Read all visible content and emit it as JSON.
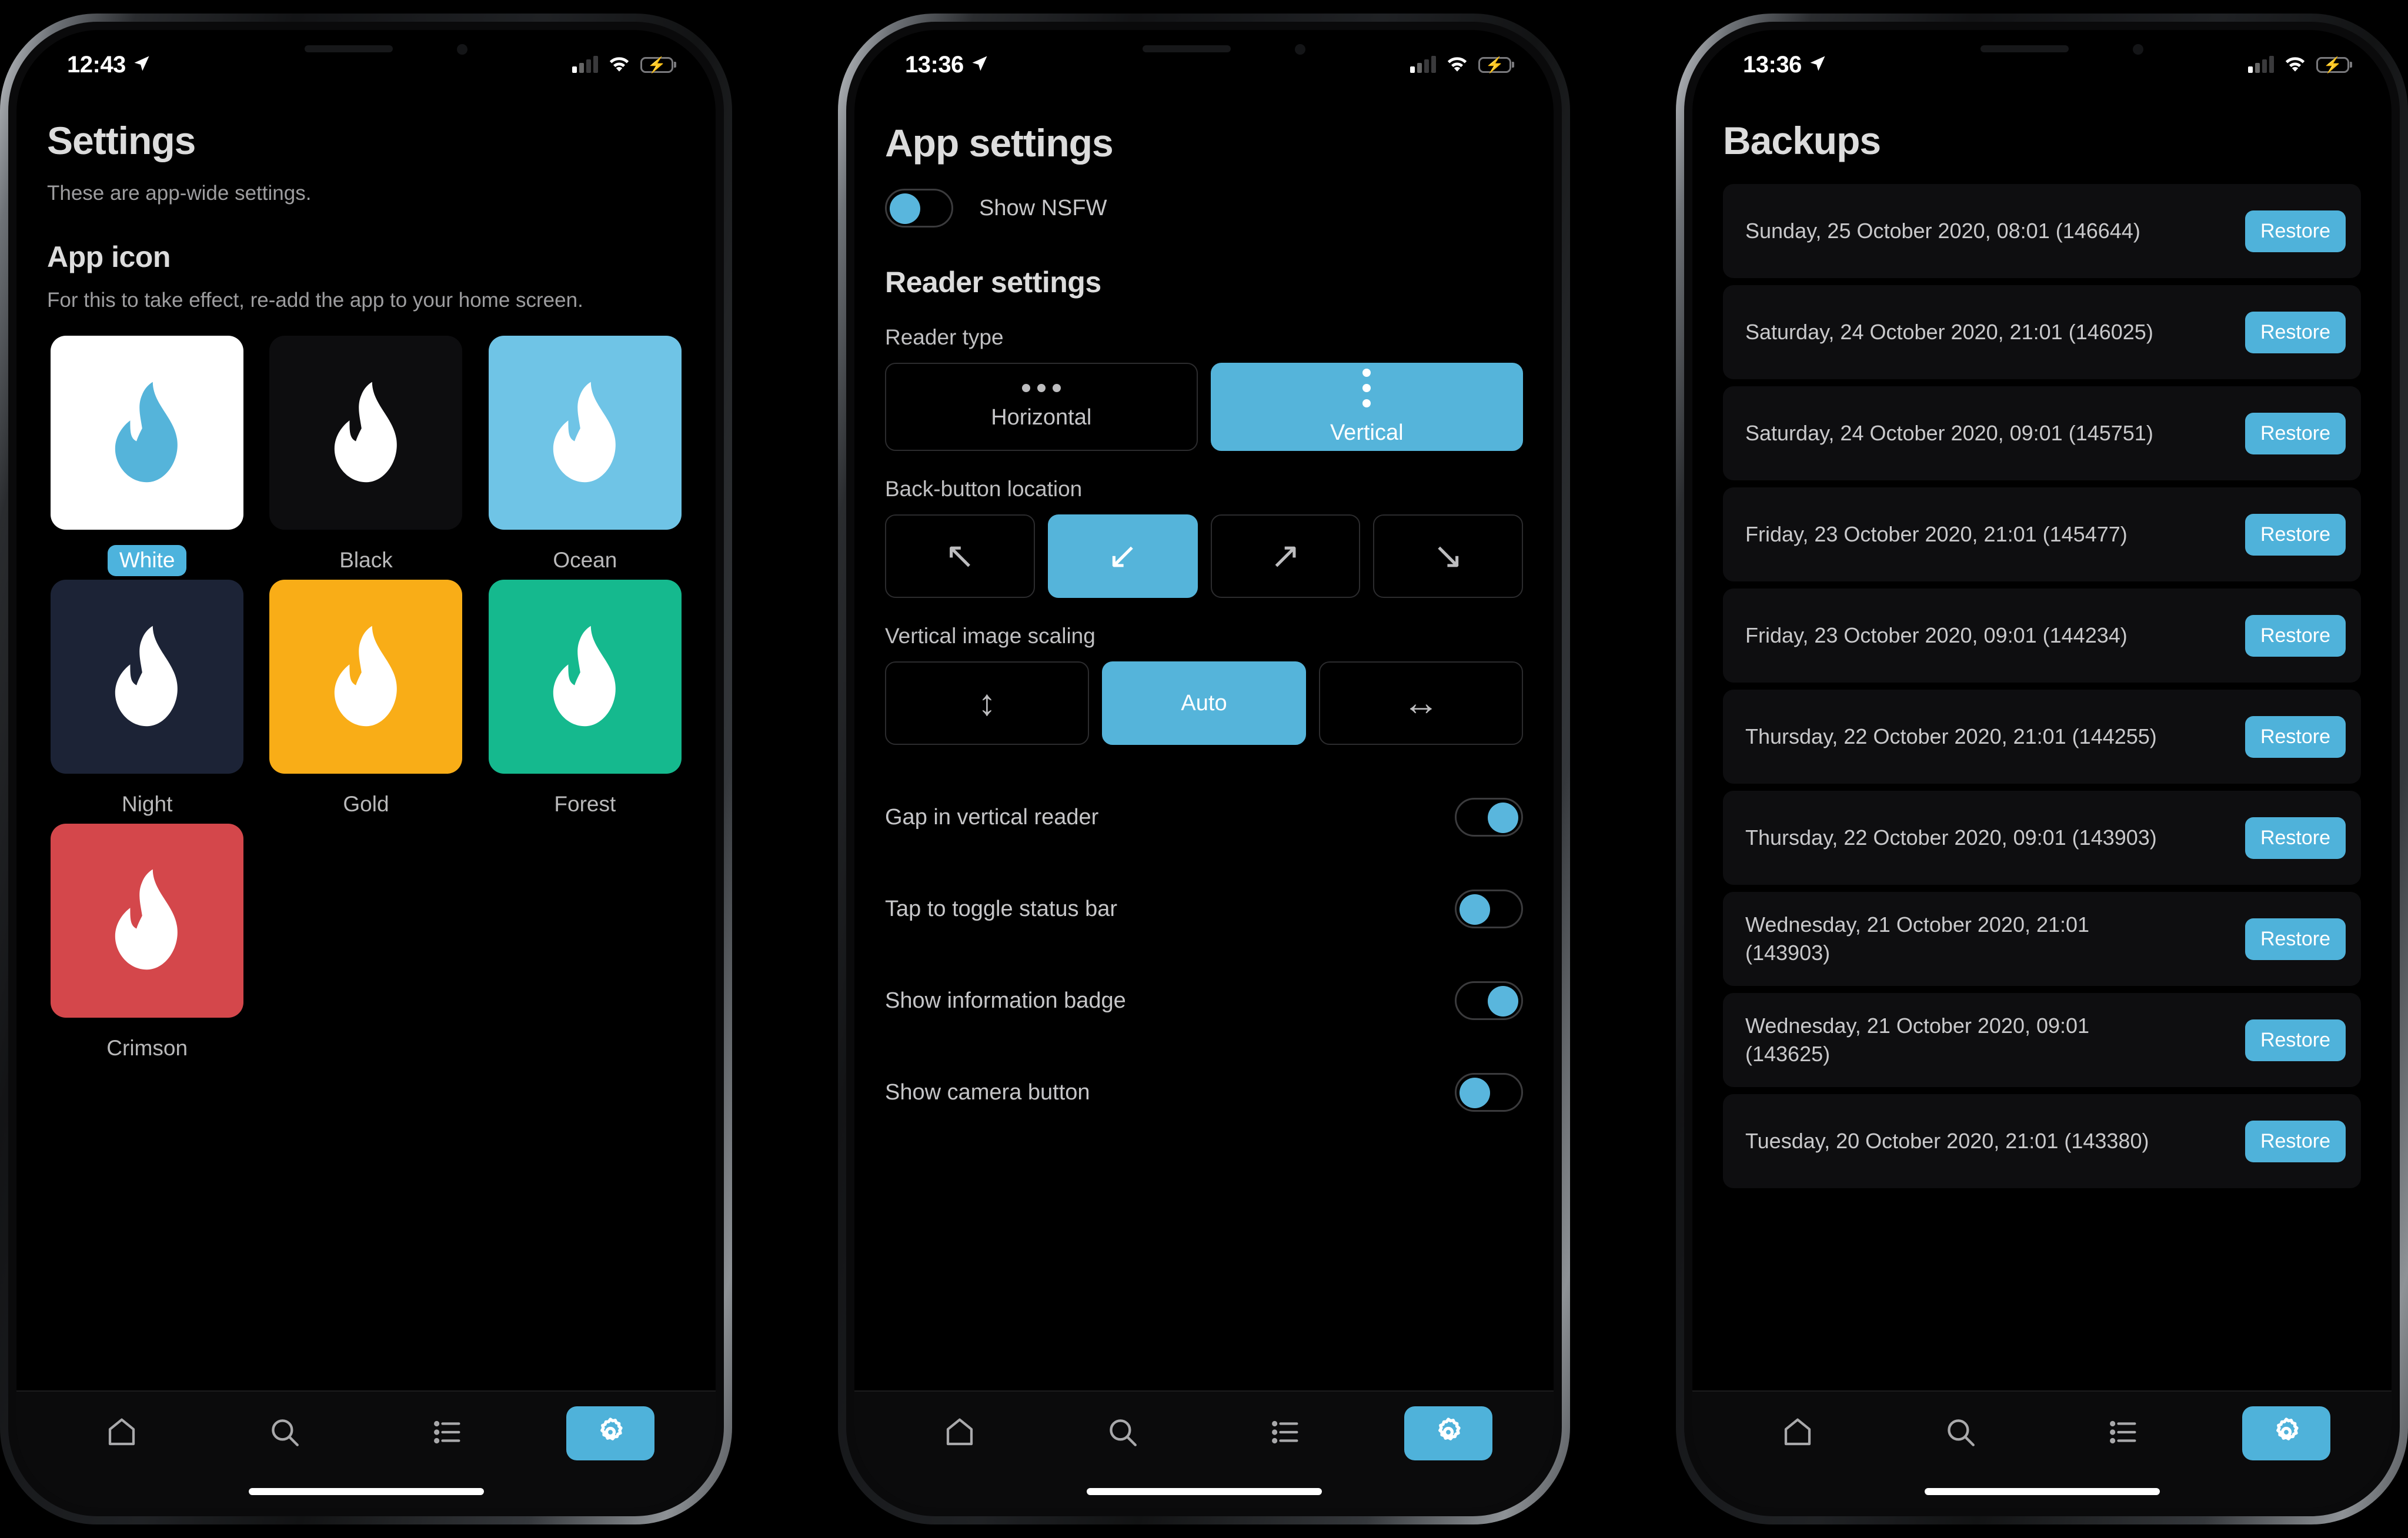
{
  "phones": [
    {
      "status": {
        "time": "12:43",
        "location_icon": "location-arrow-icon",
        "signal_icon": "cellular-signal-icon",
        "wifi_icon": "wifi-icon",
        "battery_icon": "battery-charging-icon"
      },
      "screen": {
        "title": "Settings",
        "subtitle": "These are app-wide settings.",
        "section_title": "App icon",
        "section_subtitle": "For this to take effect, re-add the app to your home screen.",
        "icons": [
          {
            "label": "White",
            "bg": "#ffffff",
            "flame": "#55b4da",
            "selected": true
          },
          {
            "label": "Black",
            "bg": "#0d0d0f",
            "flame": "#ffffff",
            "selected": false
          },
          {
            "label": "Ocean",
            "bg": "#6fc4e6",
            "flame": "#ffffff",
            "selected": false
          },
          {
            "label": "Night",
            "bg": "#1c2336",
            "flame": "#ffffff",
            "selected": false
          },
          {
            "label": "Gold",
            "bg": "#f9ad17",
            "flame": "#ffffff",
            "selected": false
          },
          {
            "label": "Forest",
            "bg": "#15b98e",
            "flame": "#ffffff",
            "selected": false
          },
          {
            "label": "Crimson",
            "bg": "#d4474b",
            "flame": "#ffffff",
            "selected": false
          }
        ]
      }
    },
    {
      "status": {
        "time": "13:36",
        "location_icon": "location-arrow-icon",
        "signal_icon": "cellular-signal-icon",
        "wifi_icon": "wifi-icon",
        "battery_icon": "battery-charging-icon"
      },
      "screen": {
        "title": "App settings",
        "nsfw": {
          "label": "Show NSFW",
          "on": false
        },
        "reader_title": "Reader settings",
        "reader_type": {
          "label": "Reader type",
          "options": [
            {
              "label": "Horizontal",
              "icon": "dots-horizontal-icon",
              "active": false
            },
            {
              "label": "Vertical",
              "icon": "dots-vertical-icon",
              "active": true
            }
          ]
        },
        "back_button": {
          "label": "Back-button location",
          "options": [
            {
              "glyph": "↖",
              "icon": "arrow-up-left-icon",
              "active": false
            },
            {
              "glyph": "↙",
              "icon": "arrow-down-left-icon",
              "active": true
            },
            {
              "glyph": "↗",
              "icon": "arrow-up-right-icon",
              "active": false
            },
            {
              "glyph": "↘",
              "icon": "arrow-down-right-icon",
              "active": false
            }
          ]
        },
        "scaling": {
          "label": "Vertical image scaling",
          "options": [
            {
              "glyph": "↕",
              "label": "",
              "icon": "arrow-vertical-icon",
              "active": false
            },
            {
              "glyph": "",
              "label": "Auto",
              "icon": "",
              "active": true
            },
            {
              "glyph": "↔",
              "label": "",
              "icon": "arrow-horizontal-icon",
              "active": false
            }
          ]
        },
        "switches": [
          {
            "label": "Gap in vertical reader",
            "on": true
          },
          {
            "label": "Tap to toggle status bar",
            "on": false
          },
          {
            "label": "Show information badge",
            "on": true
          },
          {
            "label": "Show camera button",
            "on": false
          }
        ]
      }
    },
    {
      "status": {
        "time": "13:36",
        "location_icon": "location-arrow-icon",
        "signal_icon": "cellular-signal-icon",
        "wifi_icon": "wifi-icon",
        "battery_icon": "battery-charging-icon"
      },
      "screen": {
        "title": "Backups",
        "restore_label": "Restore",
        "backups": [
          {
            "date": "Sunday, 25 October 2020, 08:01 (146644)"
          },
          {
            "date": "Saturday, 24 October 2020, 21:01 (146025)"
          },
          {
            "date": "Saturday, 24 October 2020, 09:01 (145751)"
          },
          {
            "date": "Friday, 23 October 2020, 21:01 (145477)"
          },
          {
            "date": "Friday, 23 October 2020, 09:01 (144234)"
          },
          {
            "date": "Thursday, 22 October 2020, 21:01 (144255)"
          },
          {
            "date": "Thursday, 22 October 2020, 09:01 (143903)"
          },
          {
            "date": "Wednesday, 21 October 2020, 21:01 (143903)"
          },
          {
            "date": "Wednesday, 21 October 2020, 09:01 (143625)"
          },
          {
            "date": "Tuesday, 20 October 2020, 21:01 (143380)"
          }
        ]
      }
    }
  ],
  "tabbar": {
    "items": [
      {
        "icon": "home-icon",
        "active": false
      },
      {
        "icon": "search-icon",
        "active": false
      },
      {
        "icon": "list-icon",
        "active": false
      },
      {
        "icon": "gear-icon",
        "active": true
      }
    ]
  },
  "colors": {
    "accent": "#4fb2da",
    "accent_light": "#55b4da",
    "text": "#dcdcdc",
    "muted": "#9d9d9f",
    "card": "#0e0e10"
  }
}
